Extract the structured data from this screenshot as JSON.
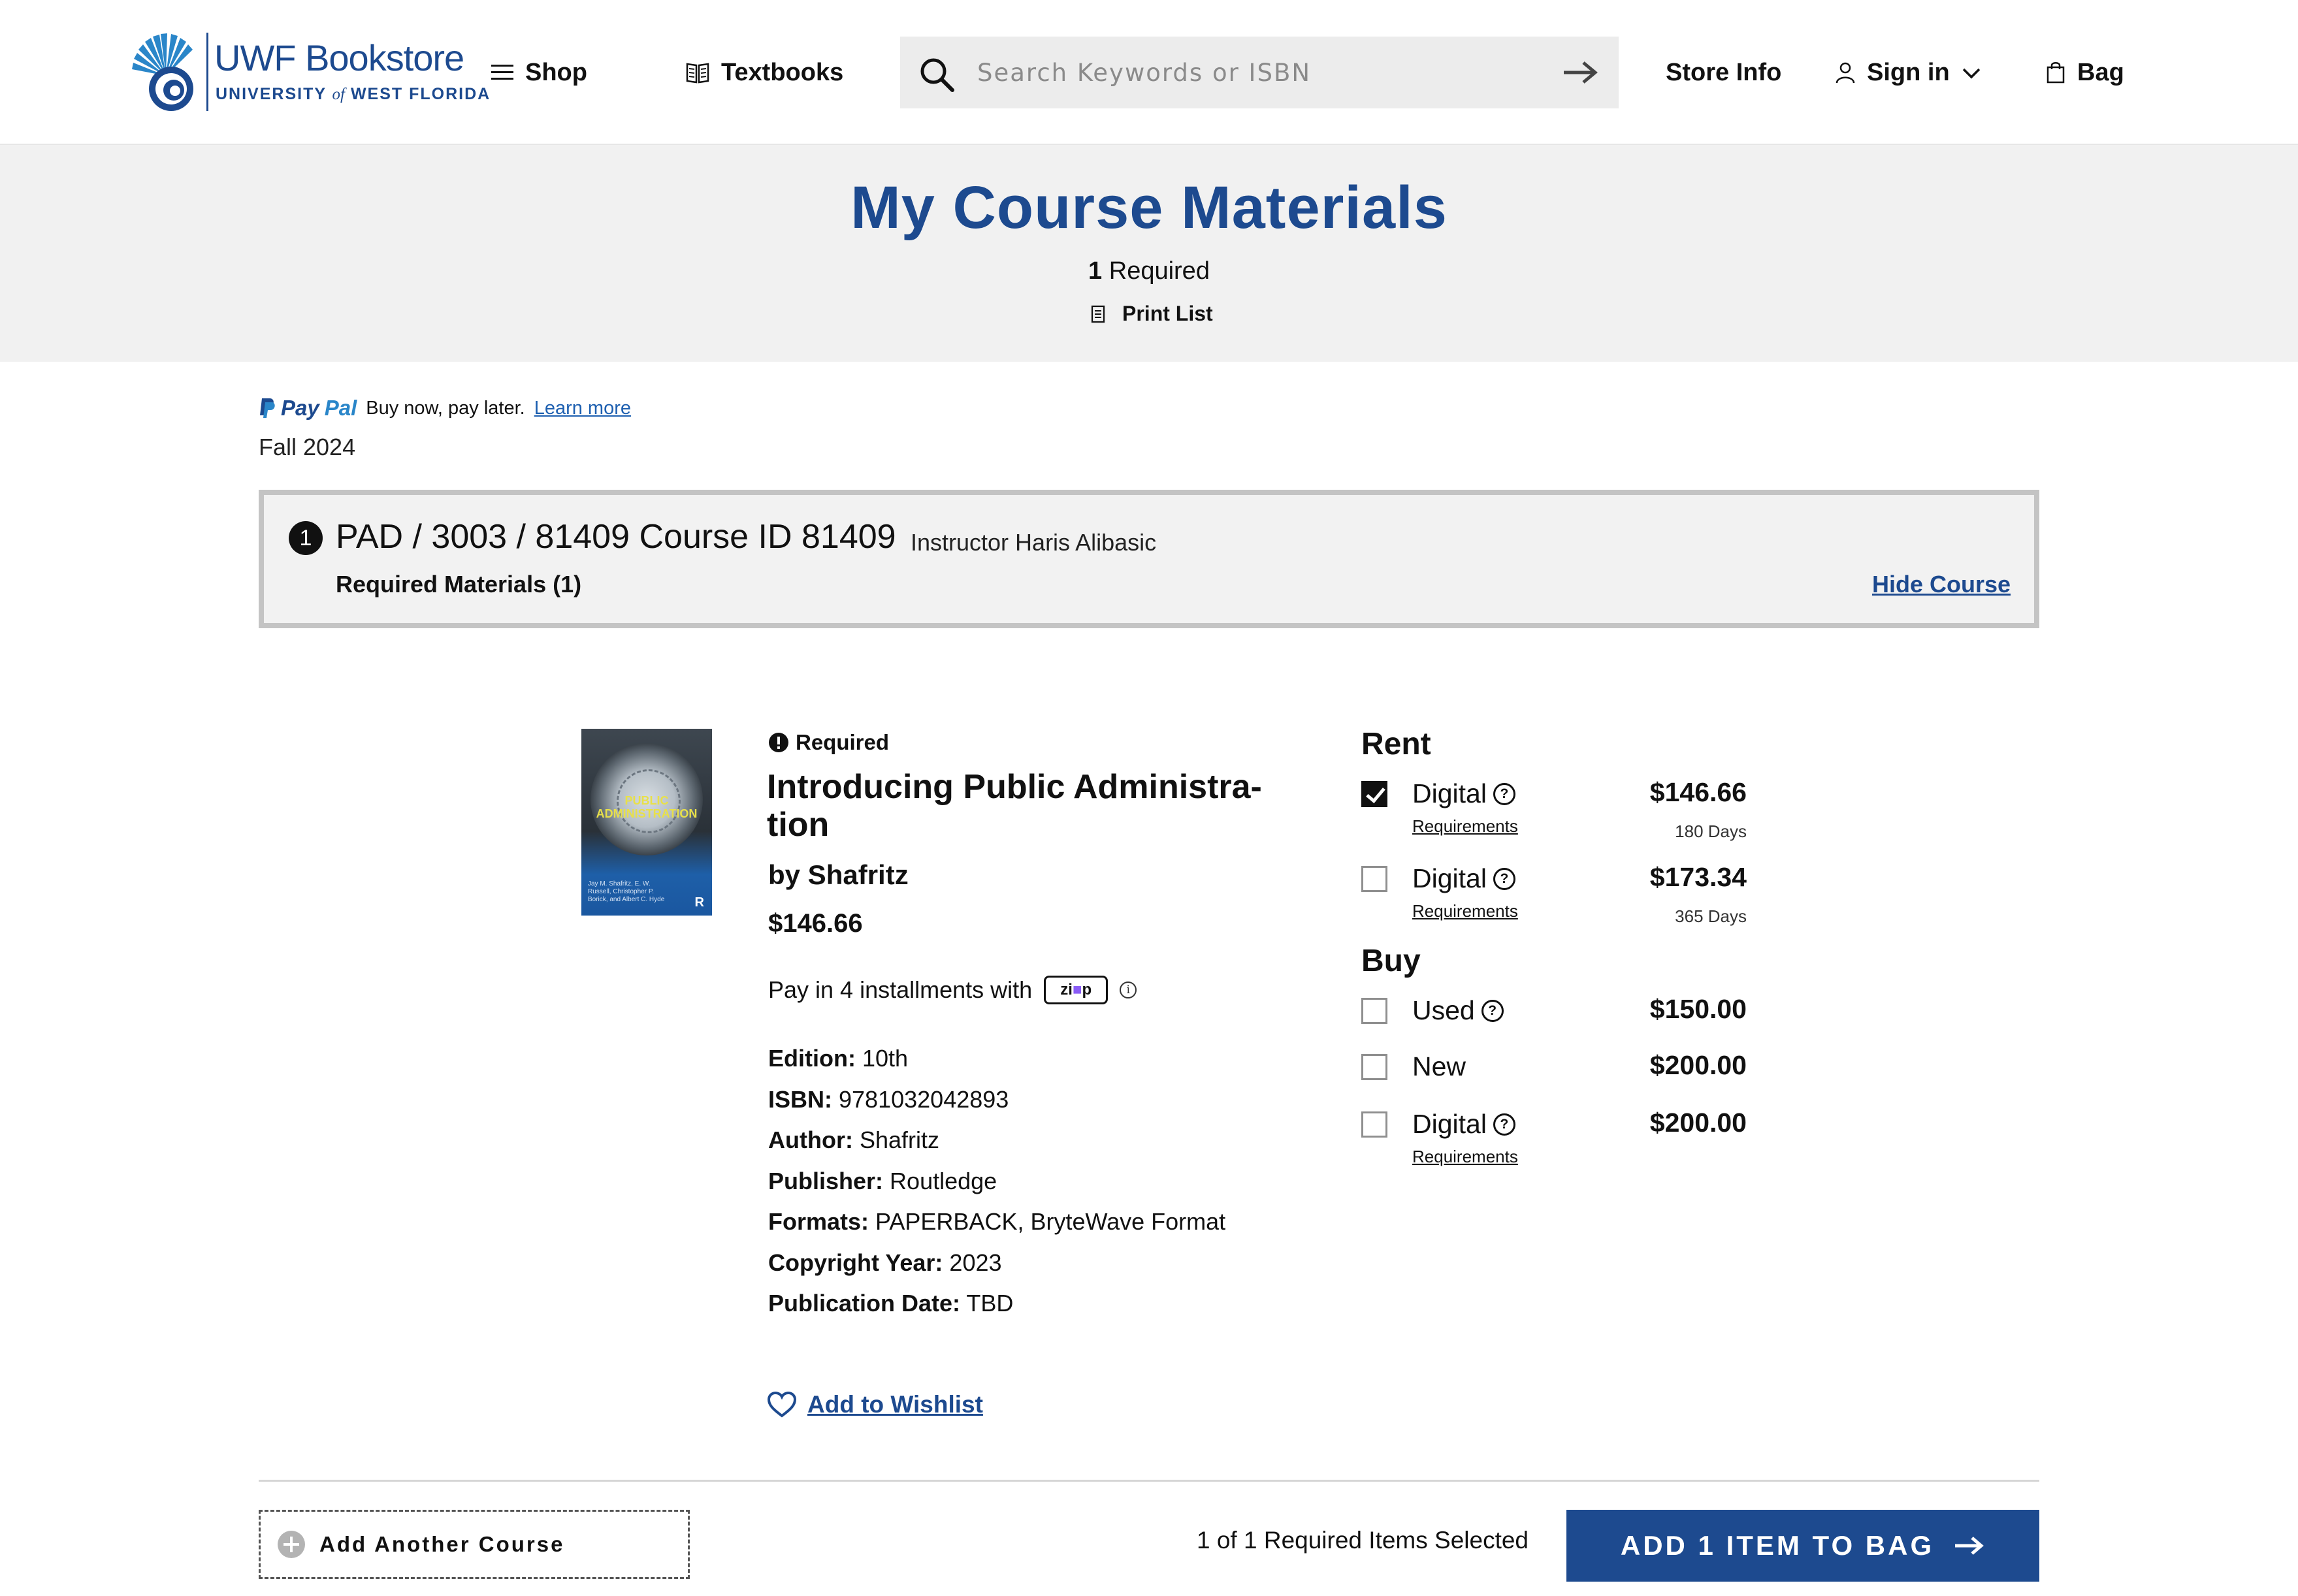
{
  "header": {
    "logo_title": "UWF Bookstore",
    "logo_sub_left": "UNIVERSITY",
    "logo_sub_of": "of",
    "logo_sub_right": "WEST FLORIDA",
    "nav": {
      "shop": "Shop",
      "textbooks": "Textbooks",
      "store_info": "Store Info",
      "sign_in": "Sign in",
      "bag": "Bag"
    },
    "search_placeholder": "Search Keywords or ISBN"
  },
  "banner": {
    "title": "My Course Materials",
    "required_count": "1",
    "required_label": " Required",
    "print_list": "Print List"
  },
  "paypal": {
    "brand_pay": "Pay",
    "brand_pal": "Pal",
    "text": "Buy now, pay later.",
    "link": "Learn more"
  },
  "term": "Fall 2024",
  "course": {
    "number": "1",
    "title": "PAD / 3003 / 81409 Course ID 81409",
    "instructor": "Instructor Haris Alibasic",
    "required_materials": "Required Materials (1)",
    "hide_label": "Hide Course"
  },
  "product": {
    "required_flag": "Required",
    "title": "Introducing Public Administra-tion",
    "author_line": "by Shafritz",
    "price": "$146.66",
    "zip_text": "Pay in 4 installments with",
    "zip_badge_left": "zi",
    "zip_badge_mid": "■",
    "zip_badge_right": "p",
    "cover": {
      "title": "PUBLIC ADMINISTRATION",
      "authors": "Jay M. Shafritz, E. W. Russell, Christopher P. Borick, and Albert C. Hyde",
      "publisher_mark": "R"
    },
    "details": [
      {
        "label": "Edition:",
        "value": "10th"
      },
      {
        "label": "ISBN:",
        "value": "9781032042893"
      },
      {
        "label": "Author:",
        "value": "Shafritz"
      },
      {
        "label": "Publisher:",
        "value": "Routledge"
      },
      {
        "label": "Formats:",
        "value": "PAPERBACK, BryteWave Format"
      },
      {
        "label": "Copyright Year:",
        "value": "2023"
      },
      {
        "label": "Publication Date:",
        "value": "TBD"
      }
    ],
    "wishlist": "Add to Wishlist"
  },
  "options": {
    "rent_heading": "Rent",
    "buy_heading": "Buy",
    "rent": [
      {
        "label": "Digital",
        "price": "$146.66",
        "days": "180 Days",
        "requirements": "Requirements",
        "checked": true
      },
      {
        "label": "Digital",
        "price": "$173.34",
        "days": "365 Days",
        "requirements": "Requirements",
        "checked": false
      }
    ],
    "buy": [
      {
        "label": "Used",
        "price": "$150.00",
        "checked": false
      },
      {
        "label": "New",
        "price": "$200.00",
        "checked": false
      },
      {
        "label": "Digital",
        "price": "$200.00",
        "requirements": "Requirements",
        "checked": false
      }
    ]
  },
  "footer": {
    "add_course": "Add Another Course",
    "selected": "1 of 1 Required Items Selected",
    "add_to_bag": "ADD 1 ITEM TO BAG"
  },
  "colors": {
    "brand_blue": "#1d4a8f",
    "banner_bg": "#f1f1f1",
    "zip_purple": "#8a5cf6"
  }
}
